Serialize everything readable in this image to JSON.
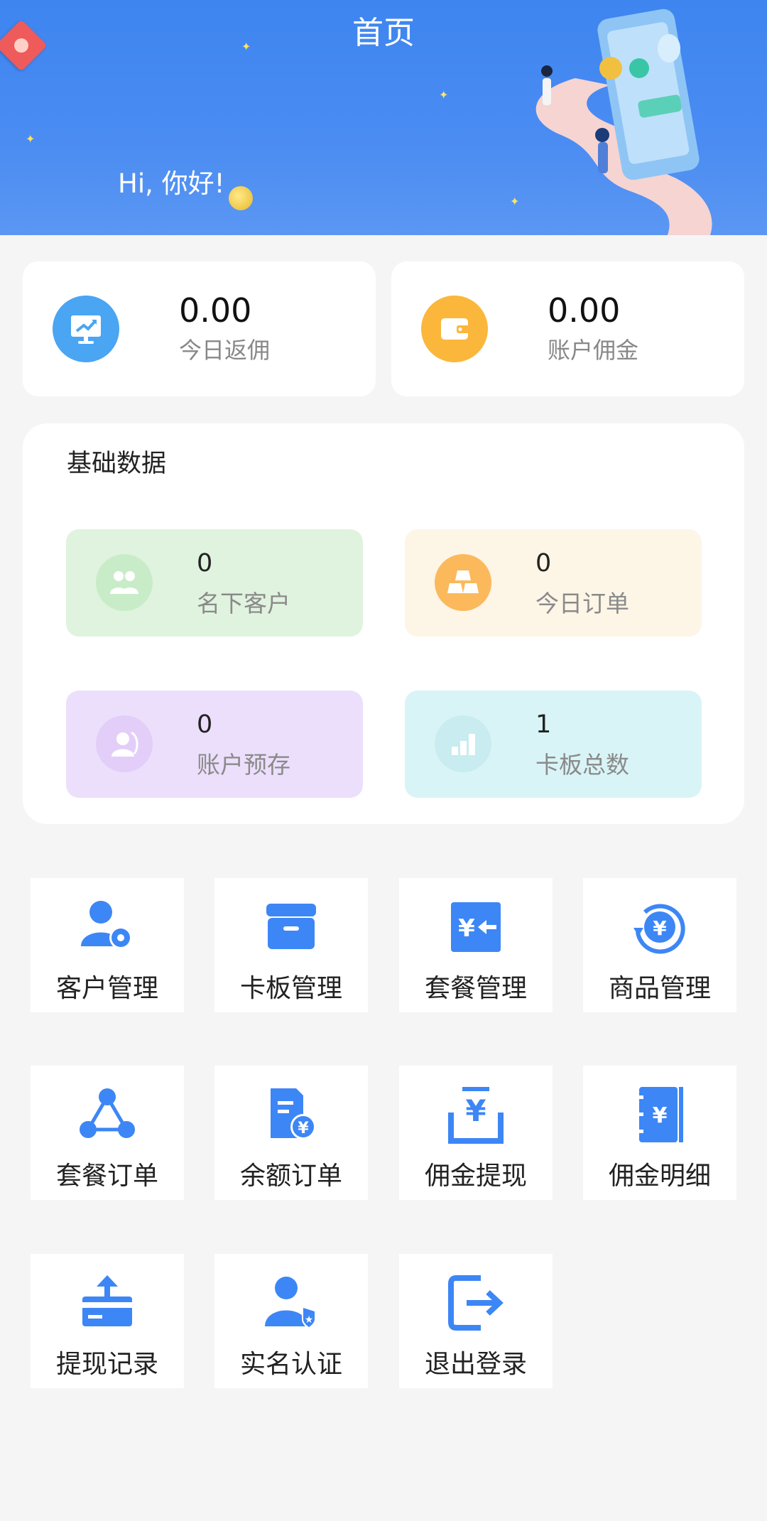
{
  "header": {
    "title": "首页",
    "greeting": "Hi, 你好!"
  },
  "stats": [
    {
      "value": "0.00",
      "label": "今日返佣",
      "icon": "trend-screen-icon",
      "color": "#4aa5f2"
    },
    {
      "value": "0.00",
      "label": "账户佣金",
      "icon": "wallet-icon",
      "color": "#fbb73c"
    }
  ],
  "basic_data": {
    "title": "基础数据",
    "tiles": [
      {
        "value": "0",
        "label": "名下客户",
        "icon": "users-icon",
        "bg": "#e0f3df",
        "icon_bg": "#c8ecc8"
      },
      {
        "value": "0",
        "label": "今日订单",
        "icon": "gold-bars-icon",
        "bg": "#fdf5e6",
        "icon_bg": "#fbb95c"
      },
      {
        "value": "0",
        "label": "账户预存",
        "icon": "user-circle-icon",
        "bg": "#ecdffc",
        "icon_bg": "#e2cef8"
      },
      {
        "value": "1",
        "label": "卡板总数",
        "icon": "bar-chart-icon",
        "bg": "#d9f4f6",
        "icon_bg": "#c8ecef"
      }
    ]
  },
  "menu": [
    {
      "label": "客户管理",
      "icon": "user-settings-icon"
    },
    {
      "label": "卡板管理",
      "icon": "box-icon"
    },
    {
      "label": "套餐管理",
      "icon": "yuan-transfer-icon"
    },
    {
      "label": "商品管理",
      "icon": "yuan-refresh-icon"
    },
    {
      "label": "套餐订单",
      "icon": "network-icon"
    },
    {
      "label": "余额订单",
      "icon": "document-yuan-icon"
    },
    {
      "label": "佣金提现",
      "icon": "yuan-withdraw-icon"
    },
    {
      "label": "佣金明细",
      "icon": "ledger-icon"
    },
    {
      "label": "提现记录",
      "icon": "card-upload-icon"
    },
    {
      "label": "实名认证",
      "icon": "user-badge-icon"
    },
    {
      "label": "退出登录",
      "icon": "logout-icon"
    }
  ],
  "theme": {
    "accent": "#3d86f5"
  }
}
